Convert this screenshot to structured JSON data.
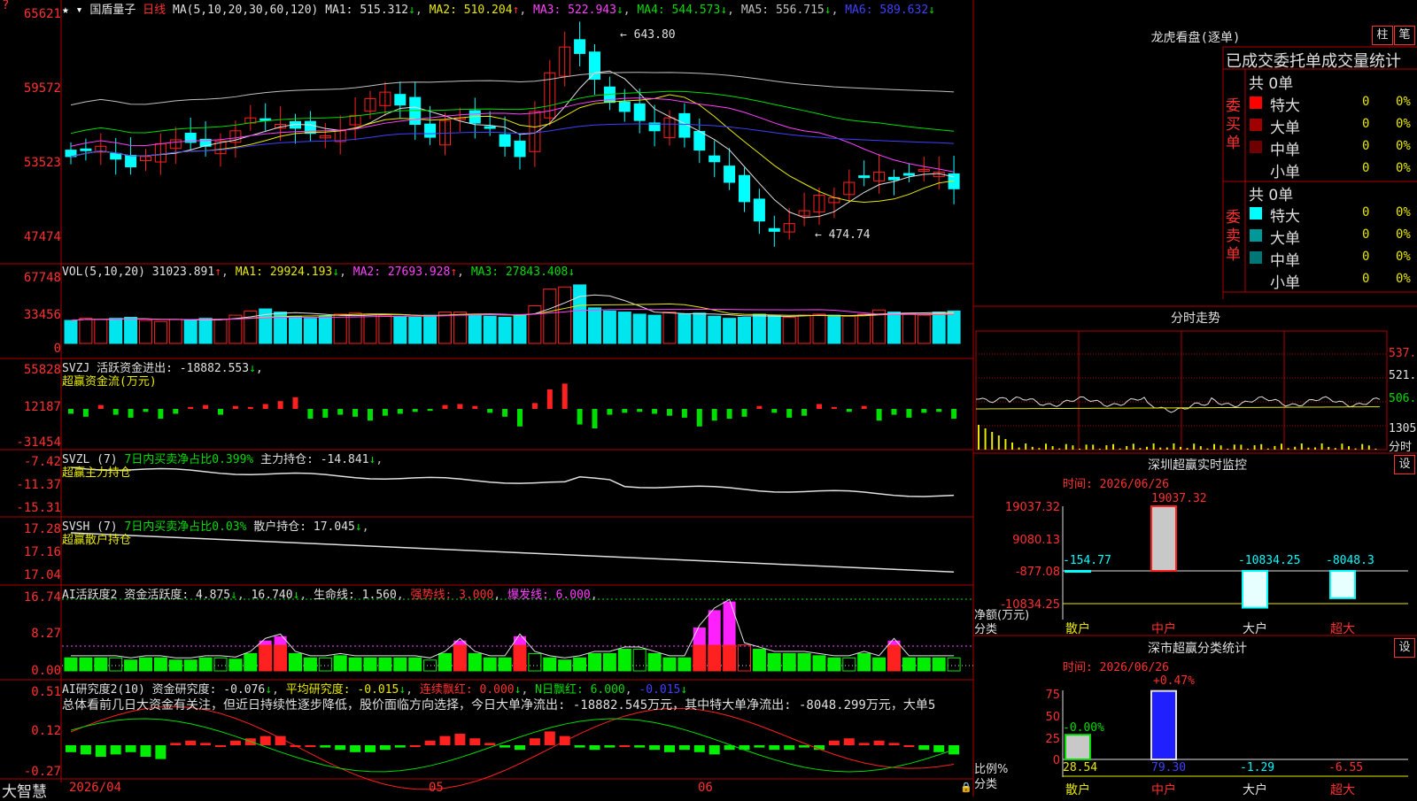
{
  "main": {
    "stock_name": "国盾量子",
    "period": "日线",
    "ma_header": "MA(5,10,20,30,60,120)",
    "ma": [
      {
        "label": "MA1: 515.312",
        "arrow": "↓",
        "color": "#e0e0e0"
      },
      {
        "label": "MA2: 510.204",
        "arrow": "↑",
        "color": "#e8e800"
      },
      {
        "label": "MA3: 522.943",
        "arrow": "↓",
        "color": "#ff40ff"
      },
      {
        "label": "MA4: 544.573",
        "arrow": "↓",
        "color": "#00dd00"
      },
      {
        "label": "MA5: 556.715",
        "arrow": "↓",
        "color": "#c0c0c0"
      },
      {
        "label": "MA6: 589.632",
        "arrow": "↓",
        "color": "#4040ff"
      }
    ],
    "y_ticks": [
      "65621",
      "59572",
      "53523",
      "47474"
    ],
    "high_label": "643.80",
    "low_label": "474.74"
  },
  "vol": {
    "header": "VOL(5,10,20)",
    "value": "31023.891",
    "ma1": "MA1: 29924.193",
    "ma2": "MA2: 27693.928",
    "ma3": "MA3: 27843.408",
    "y_ticks": [
      "67748",
      "33456",
      "0"
    ]
  },
  "svzj": {
    "header": "SVZJ  活跃资金进出: -18882.553",
    "subtitle": "超赢资金流(万元)",
    "y_ticks": [
      "55828",
      "12187",
      "-31454"
    ]
  },
  "svzl": {
    "header": "SVZL (7)",
    "green_text": "7日内买卖净占比0.399%",
    "white_text": "主力持仓: -14.841",
    "subtitle": "超赢主力持仓",
    "y_ticks": [
      "-7.42",
      "-11.37",
      "-15.31"
    ]
  },
  "svsh": {
    "header": "SVSH (7)",
    "green_text": "7日内买卖净占比0.03%",
    "white_text": "散户持仓: 17.045",
    "subtitle": "超赢散户持仓",
    "y_ticks": [
      "17.28",
      "17.16",
      "17.04"
    ]
  },
  "ai_active": {
    "header": "AI活跃度2",
    "v1": "资金活跃度: 4.875",
    "v2": "16.740",
    "v3": "生命线: 1.560",
    "v4": "强势线: 3.000",
    "v5": "爆发线: 6.000",
    "y_ticks": [
      "16.74",
      "8.27",
      "0.00"
    ]
  },
  "ai_research": {
    "header": "AI研究度2(10)",
    "v1": "资金研究度: -0.076",
    "v2": "平均研究度: -0.015",
    "v3": "连续飘红: 0.000",
    "v4": "N日飘红: 6.000",
    "v5": "-0.015",
    "summary": "总体看前几日大资金有关注，但近日持续性逐步降低，股价面临方向选择，今日大单净流出: -18882.545万元，其中特大单净流出: -8048.299万元，大单5",
    "y_ticks": [
      "0.51",
      "0.12",
      "-0.27"
    ]
  },
  "xaxis": {
    "labels": [
      "2026/04",
      "05",
      "06"
    ],
    "brand": "大智慧"
  },
  "dragon": {
    "title": "龙虎看盘(逐单)",
    "btn1": "柱",
    "btn2": "笔",
    "tabs": "已成交委托单成交量统计",
    "buy_label": "委买单",
    "sell_label": "委卖单",
    "buy_total": "共 0单",
    "sell_total": "共 0单",
    "buy_rows": [
      {
        "name": "特大",
        "count": "0",
        "pct": "0%",
        "color": "#ff0000"
      },
      {
        "name": "大单",
        "count": "0",
        "pct": "0%",
        "color": "#a00000"
      },
      {
        "name": "中单",
        "count": "0",
        "pct": "0%",
        "color": "#700000"
      },
      {
        "name": "小单",
        "count": "0",
        "pct": "0%",
        "color": ""
      }
    ],
    "sell_rows": [
      {
        "name": "特大",
        "count": "0",
        "pct": "0%",
        "color": "#00ffff"
      },
      {
        "name": "大单",
        "count": "0",
        "pct": "0%",
        "color": "#009999"
      },
      {
        "name": "中单",
        "count": "0",
        "pct": "0%",
        "color": "#007777"
      },
      {
        "name": "小单",
        "count": "0",
        "pct": "0%",
        "color": ""
      }
    ]
  },
  "intraday": {
    "title": "分时走势",
    "y_ticks": [
      "537.1",
      "521.7",
      "506.4",
      "1305"
    ],
    "footer": "分时"
  },
  "sz_monitor": {
    "title": "深圳超赢实时监控",
    "btn": "设",
    "time": "时间: 2026/06/26",
    "y_ticks": [
      "19037.32",
      "9080.13",
      "-877.08",
      "-10834.25"
    ],
    "ylabel": "净额(万元)",
    "xlabel": "分类",
    "categories": [
      "散户",
      "中户",
      "大户",
      "超大"
    ],
    "values": [
      -154.77,
      19037.32,
      -10834.25,
      -8048.3
    ],
    "value_labels": [
      "-154.77",
      "19037.32",
      "-10834.25",
      "-8048.3"
    ]
  },
  "sz_stats": {
    "title": "深市超赢分类统计",
    "btn": "设",
    "time": "时间: 2026/06/26",
    "y_ticks": [
      "75",
      "50",
      "25",
      "0"
    ],
    "ylabel": "比例%",
    "xlabel": "分类",
    "categories": [
      "散户",
      "中户",
      "大户",
      "超大"
    ],
    "top_labels": [
      "-0.00%",
      "+0.47%",
      "",
      ""
    ],
    "values": [
      28.54,
      79.3,
      -1.29,
      -6.55
    ],
    "value_labels": [
      "28.54",
      "79.30",
      "-1.29",
      "-6.55"
    ]
  },
  "colors": {
    "up": "#ff2020",
    "down": "#00ffff",
    "grid": "#b00000",
    "vol_down": "#00e5ee"
  }
}
